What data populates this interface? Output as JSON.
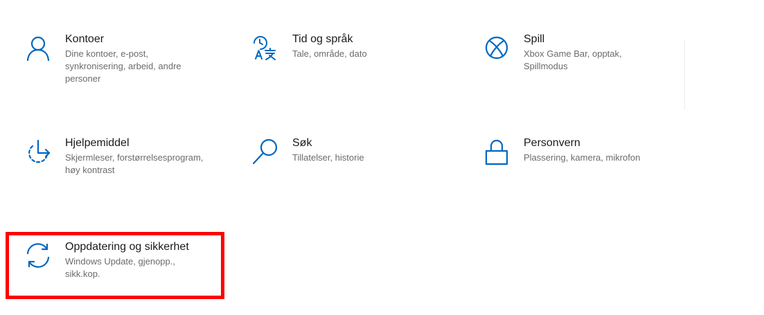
{
  "settings": {
    "tiles": [
      {
        "key": "accounts",
        "title": "Kontoer",
        "desc": "Dine kontoer, e-post, synkronisering, arbeid, andre personer",
        "icon": "person-icon"
      },
      {
        "key": "time-language",
        "title": "Tid og språk",
        "desc": "Tale, område, dato",
        "icon": "time-language-icon"
      },
      {
        "key": "gaming",
        "title": "Spill",
        "desc": "Xbox Game Bar, opptak, Spillmodus",
        "icon": "xbox-icon"
      },
      {
        "key": "ease-of-access",
        "title": "Hjelpemiddel",
        "desc": "Skjermleser, forstørrelsesprogram, høy kontrast",
        "icon": "ease-of-access-icon"
      },
      {
        "key": "search",
        "title": "Søk",
        "desc": "Tillatelser, historie",
        "icon": "search-icon"
      },
      {
        "key": "privacy",
        "title": "Personvern",
        "desc": "Plassering, kamera, mikrofon",
        "icon": "lock-icon"
      },
      {
        "key": "update-security",
        "title": "Oppdatering og sikkerhet",
        "desc": "Windows Update, gjenopp., sikk.kop.",
        "icon": "sync-icon"
      }
    ]
  },
  "colors": {
    "accent": "#0067c0",
    "highlight": "#ff0000",
    "title_text": "#1a1a1a",
    "desc_text": "#6b6b6b"
  }
}
